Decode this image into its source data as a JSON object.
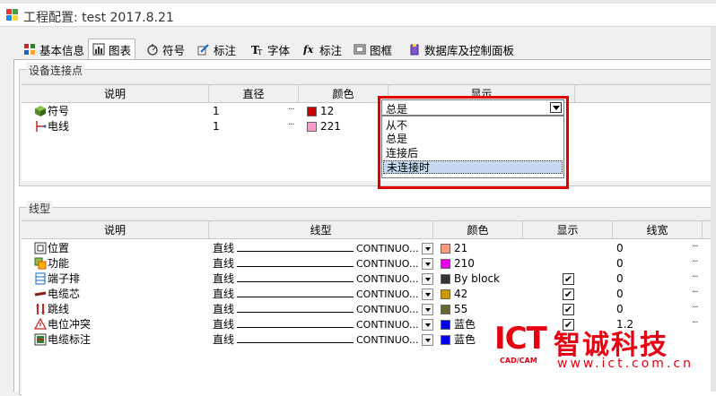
{
  "window": {
    "title": "工程配置: test 2017.8.21"
  },
  "tabs": [
    {
      "label": "基本信息",
      "icon": "basic-info-icon"
    },
    {
      "label": "图表",
      "icon": "chart-icon",
      "active": true
    },
    {
      "label": "符号",
      "icon": "symbol-icon"
    },
    {
      "label": "标注",
      "icon": "annotation-icon"
    },
    {
      "label": "字体",
      "icon": "font-icon"
    },
    {
      "label": "标注",
      "icon": "fx-annotation-icon"
    },
    {
      "label": "图框",
      "icon": "frame-icon"
    },
    {
      "label": "数据库及控制面板",
      "icon": "database-icon"
    }
  ],
  "connections": {
    "group_label": "设备连接点",
    "headers": {
      "desc": "说明",
      "diameter": "直径",
      "color": "颜色",
      "display": "显示"
    },
    "rows": [
      {
        "desc": "符号",
        "diameter": "1",
        "dots": "···",
        "color_label": "12",
        "color": "#cc0000",
        "icon": "symbol-cube-icon"
      },
      {
        "desc": "电线",
        "diameter": "1",
        "dots": "···",
        "color_label": "221",
        "color": "#ff99cc",
        "icon": "wire-icon"
      }
    ],
    "combo_value": "总是",
    "options": [
      "从不",
      "总是",
      "连接后",
      "未连接时"
    ],
    "selected_option": "未连接时"
  },
  "linetypes": {
    "group_label": "线型",
    "headers": {
      "desc": "说明",
      "linetype": "线型",
      "color": "颜色",
      "display": "显示",
      "width": "线宽"
    },
    "rows": [
      {
        "desc": "位置",
        "lt_name": "直线",
        "lt_code": "CONTINUO...",
        "color_label": "21",
        "color": "#ff9980",
        "checked": "",
        "width": "0",
        "dots": "···",
        "icon": "position-icon"
      },
      {
        "desc": "功能",
        "lt_name": "直线",
        "lt_code": "CONTINUO...",
        "color_label": "210",
        "color": "#e600e6",
        "checked": "",
        "width": "0",
        "dots": "···",
        "icon": "function-icon"
      },
      {
        "desc": "端子排",
        "lt_name": "直线",
        "lt_code": "CONTINUO...",
        "color_label": "By block",
        "color": "#333333",
        "checked": "✔",
        "width": "0",
        "dots": "···",
        "icon": "terminal-strip-icon"
      },
      {
        "desc": "电缆芯",
        "lt_name": "直线",
        "lt_code": "CONTINUO...",
        "color_label": "42",
        "color": "#cc9900",
        "checked": "✔",
        "width": "0",
        "dots": "···",
        "icon": "cable-core-icon"
      },
      {
        "desc": "跳线",
        "lt_name": "直线",
        "lt_code": "CONTINUO...",
        "color_label": "55",
        "color": "#666633",
        "checked": "✔",
        "width": "0",
        "dots": "···",
        "icon": "jumper-icon"
      },
      {
        "desc": "电位冲突",
        "lt_name": "直线",
        "lt_code": "CONTINUO...",
        "color_label": "蓝色",
        "color": "#0000ee",
        "checked": "✔",
        "width": "1.2",
        "dots": "···",
        "icon": "potential-conflict-icon"
      },
      {
        "desc": "电缆标注",
        "lt_name": "直线",
        "lt_code": "CONTINUO...",
        "color_label": "蓝色",
        "color": "#0000ee",
        "checked": "",
        "width": "",
        "dots": "",
        "icon": "cable-label-icon"
      }
    ]
  },
  "watermark": {
    "brand": "ICT",
    "sub": "CAD/CAM",
    "cn": "智诚科技",
    "url": "www.ict.com.cn"
  }
}
